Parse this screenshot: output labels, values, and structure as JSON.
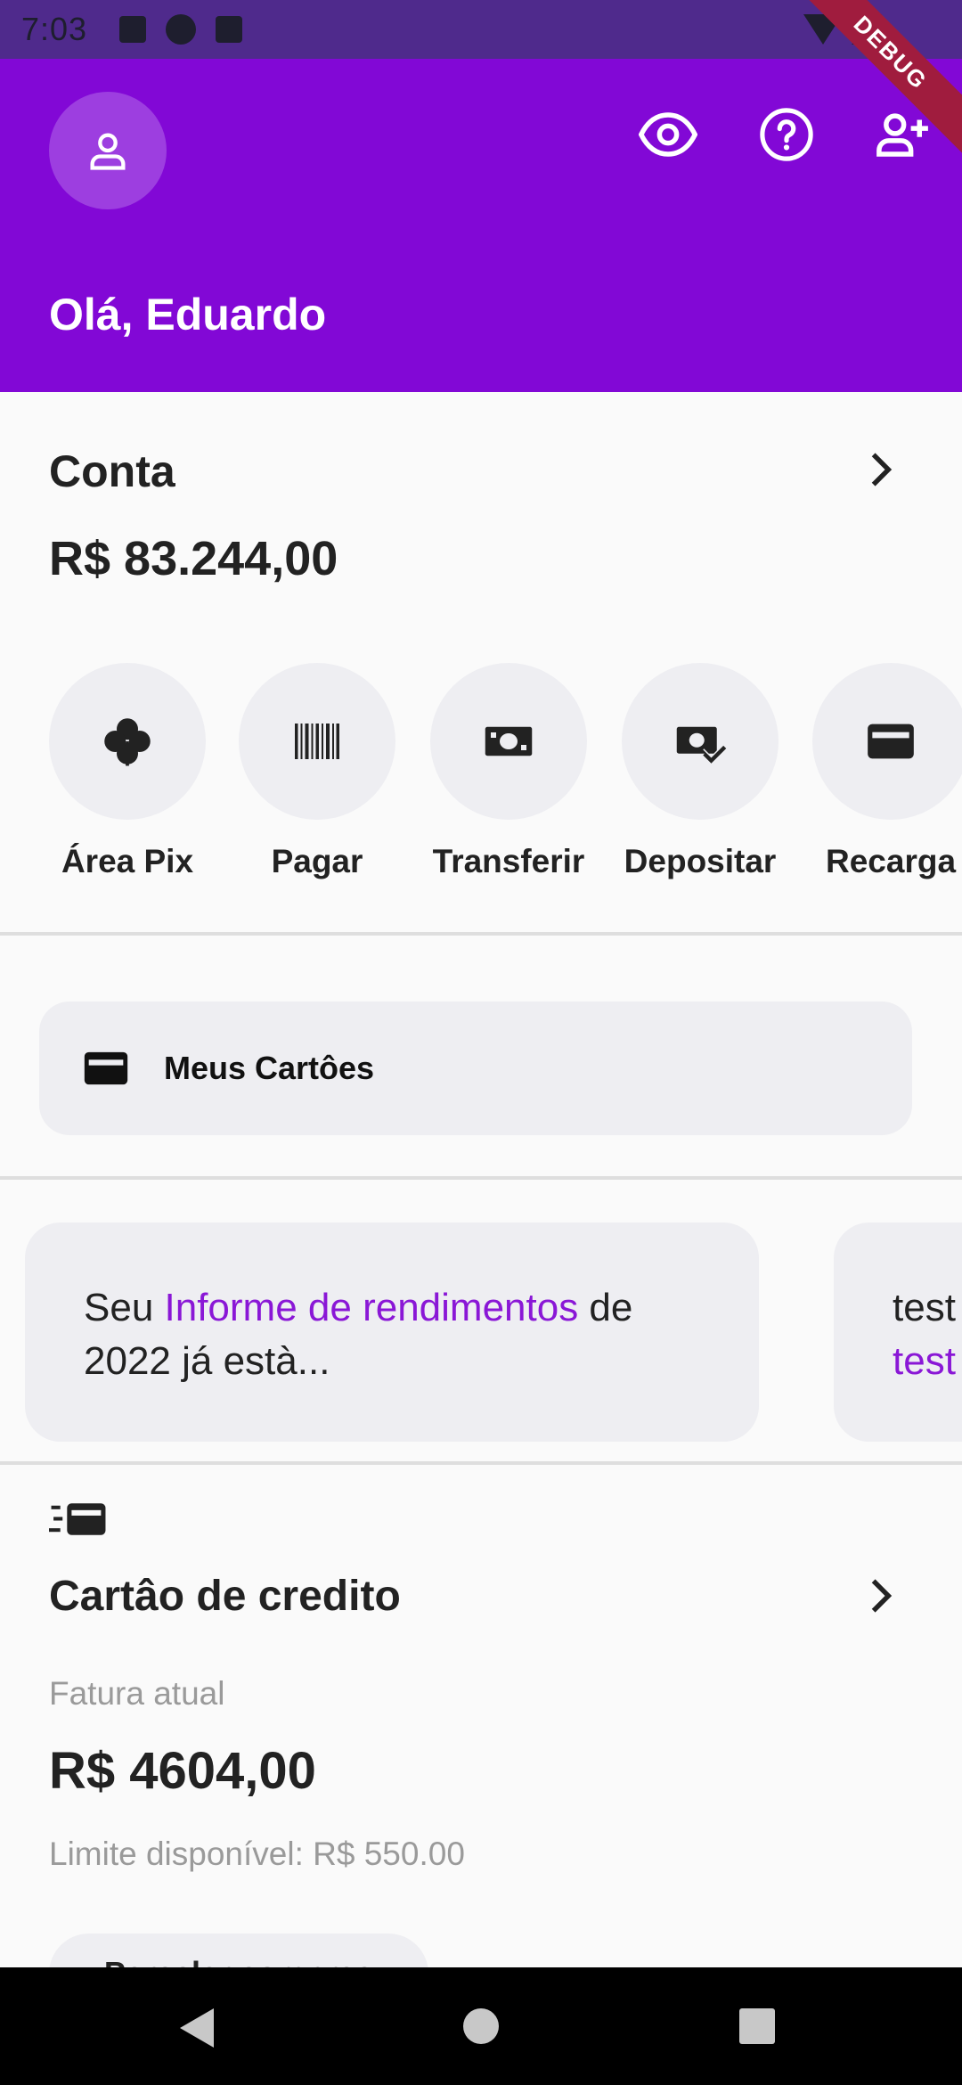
{
  "status_bar": {
    "time": "7:03",
    "debug_label": "DEBUG"
  },
  "header": {
    "greeting": "Olá, Eduardo",
    "background_color": "#8208d6",
    "icons": [
      "person-icon",
      "eye-icon",
      "help-icon",
      "add-person-icon"
    ]
  },
  "account": {
    "title": "Conta",
    "balance": "R$ 83.244,00"
  },
  "actions": [
    {
      "label": "Área Pix",
      "icon": "pix-icon"
    },
    {
      "label": "Pagar",
      "icon": "barcode-icon"
    },
    {
      "label": "Transferir",
      "icon": "money-icon"
    },
    {
      "label": "Depositar",
      "icon": "deposit-icon"
    },
    {
      "label": "Recarga",
      "icon": "credit-card-icon"
    }
  ],
  "my_cards": {
    "label": "Meus Cartôes"
  },
  "info_cards": [
    {
      "prefix": "Seu ",
      "highlight": "Informe de rendimentos",
      "suffix": " de 2022 já està..."
    },
    {
      "prefix": "test",
      "highlight": "test",
      "suffix": ""
    }
  ],
  "credit": {
    "title": "Cartâo de credito",
    "invoice_label": "Fatura atual",
    "invoice_value": "R$ 4604,00",
    "limit_text": "Limite disponível: R$ 550.00",
    "button_label": "Parcelar compras"
  },
  "accent_color": "#8a17d6"
}
